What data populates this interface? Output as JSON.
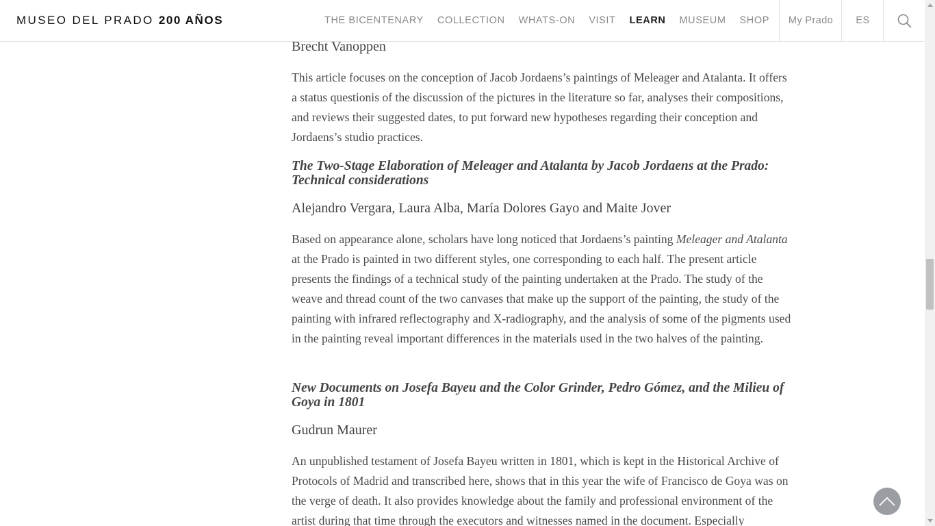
{
  "header": {
    "logo_text": "MUSEO DEL PRADO",
    "logo_bold": "200 AÑOS",
    "nav": [
      {
        "label": "THE BICENTENARY",
        "active": false
      },
      {
        "label": "COLLECTION",
        "active": false
      },
      {
        "label": "WHATS-ON",
        "active": false
      },
      {
        "label": "VISIT",
        "active": false
      },
      {
        "label": "LEARN",
        "active": true
      },
      {
        "label": "MUSEUM",
        "active": false
      },
      {
        "label": "SHOP",
        "active": false
      }
    ],
    "my_prado": "My Prado",
    "language": "ES",
    "search_icon": "search-icon"
  },
  "articles": [
    {
      "author": "Brecht Vanoppen",
      "abstract": "This article focuses on the conception of Jacob Jordaens’s paintings of Meleager and Atalanta. It offers a status questionis of the discussion of the pictures in the literature so far, analyses their compositions, and reviews their suggested dates, to put forward new hypotheses regarding their conception and Jordaens’s studio practices."
    },
    {
      "title": "The Two-Stage Elaboration of Meleager and Atalanta by Jacob Jordaens at the Prado: Technical considerations",
      "author": "Alejandro Vergara, Laura Alba, María Dolores Gayo and Maite Jover",
      "abstract_before": "Based on appearance alone, scholars have long noticed that Jordaens’s painting ",
      "abstract_italic": "Meleager and Atalanta",
      "abstract_after": " at the Prado is painted in two different styles, one corresponding to each half. The present article presents the findings of a technical study of the painting undertaken at the Prado. The study of the weave and thread count of the two canvases that make up the support of the painting, the study of the painting with infrared reflectography and X-radiography, and the analysis of some of the pigments used in the painting reveal important differences in the materials used in the two halves of the painting."
    },
    {
      "title": "New Documents on Josefa Bayeu and the Color Grinder, Pedro Gómez, and the Milieu of Goya in 1801",
      "author": "Gudrun Maurer",
      "abstract": "An unpublished testament of Josefa Bayeu written in 1801, which is kept in the Historical Archive of Protocols of Madrid and transcribed here, shows that in this year the wife of Francisco de Goya was on the verge of death. It also provides knowledge about the family and professional environment of the artist during that time through the executors and witnesses named in the document. Especially"
    }
  ],
  "back_to_top_icon": "chevron-up-icon",
  "colors": {
    "text": "#4a4a4a",
    "nav_inactive": "#8a8a8a",
    "nav_active": "#222222",
    "back_to_top": "#9a9ea3"
  }
}
